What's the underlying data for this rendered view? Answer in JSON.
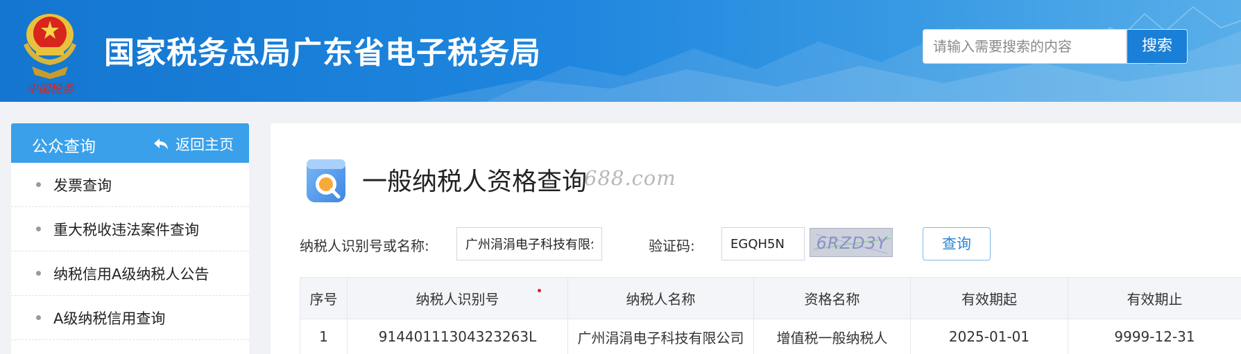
{
  "header": {
    "site_title": "国家税务总局广东省电子税务局",
    "emblem_caption": "中国税务",
    "search_placeholder": "请输入需要搜索的内容",
    "search_button": "搜索"
  },
  "sidebar": {
    "title": "公众查询",
    "back_home": "返回主页",
    "items": [
      {
        "label": "发票查询"
      },
      {
        "label": "重大税收违法案件查询"
      },
      {
        "label": "纳税信用A级纳税人公告"
      },
      {
        "label": "A级纳税信用查询"
      }
    ]
  },
  "main": {
    "page_title": "一般纳税人资格查询",
    "watermark": "688.com",
    "form": {
      "taxpayer_label": "纳税人识别号或名称:",
      "taxpayer_value": "广州涓涓电子科技有限公司",
      "captcha_label": "验证码:",
      "captcha_value": "EGQH5N",
      "captcha_image_text": "6RZD3Y",
      "query_button": "查询"
    },
    "table": {
      "headers": [
        "序号",
        "纳税人识别号",
        "纳税人名称",
        "资格名称",
        "有效期起",
        "有效期止"
      ],
      "rows": [
        [
          "1",
          "91440111304323263L",
          "广州涓涓电子科技有限公司",
          "增值税一般纳税人",
          "2025-01-01",
          "9999-12-31"
        ]
      ]
    }
  },
  "colors": {
    "header_blue": "#1476d0",
    "sidebar_head": "#3aa0ea",
    "accent": "#2a86d6"
  }
}
